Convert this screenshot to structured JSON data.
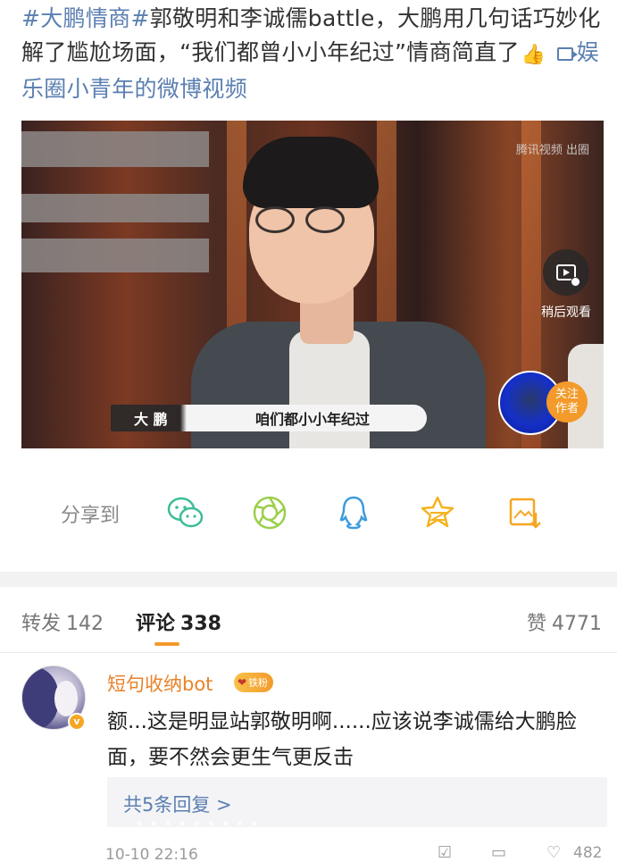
{
  "post": {
    "hashtag": "#大鹏情商#",
    "body": "郭敬明和李诚儒battle，大鹏用几句话巧妙化解了尴尬场面，“我们都曾小小年纪过”情商简直了",
    "thumb_emoji": "👍",
    "video_link_label": "娱乐圈小青年的微博视频"
  },
  "video": {
    "watermark": "腾讯视频 出圈",
    "subtitle_name": "大 鹏",
    "subtitle_text": "咱们都小小年纪过",
    "watch_later_label": "稍后观看",
    "follow_label_line1": "关注",
    "follow_label_line2": "作者"
  },
  "share": {
    "label": "分享到",
    "targets": [
      "wechat-icon",
      "moments-icon",
      "qq-icon",
      "qzone-icon",
      "save-image-icon"
    ]
  },
  "tabs": {
    "repost_label": "转发",
    "repost_count": "142",
    "comment_label": "评论",
    "comment_count": "338",
    "like_label": "赞",
    "like_count": "4771"
  },
  "comment": {
    "username": "短句收纳bot",
    "fan_badge": "铁粉",
    "verify_mark": "v",
    "text": "额...这是明显站郭敬明啊......应该说李诚儒给大鹏脸面，要不然会更生气更反击",
    "reply_link": "共5条回复 >",
    "time": "10-10 22:16",
    "like_count": "482"
  },
  "colors": {
    "link_blue": "#5b7fb1",
    "accent_orange": "#f39a2b",
    "username_orange": "#e8832a"
  }
}
